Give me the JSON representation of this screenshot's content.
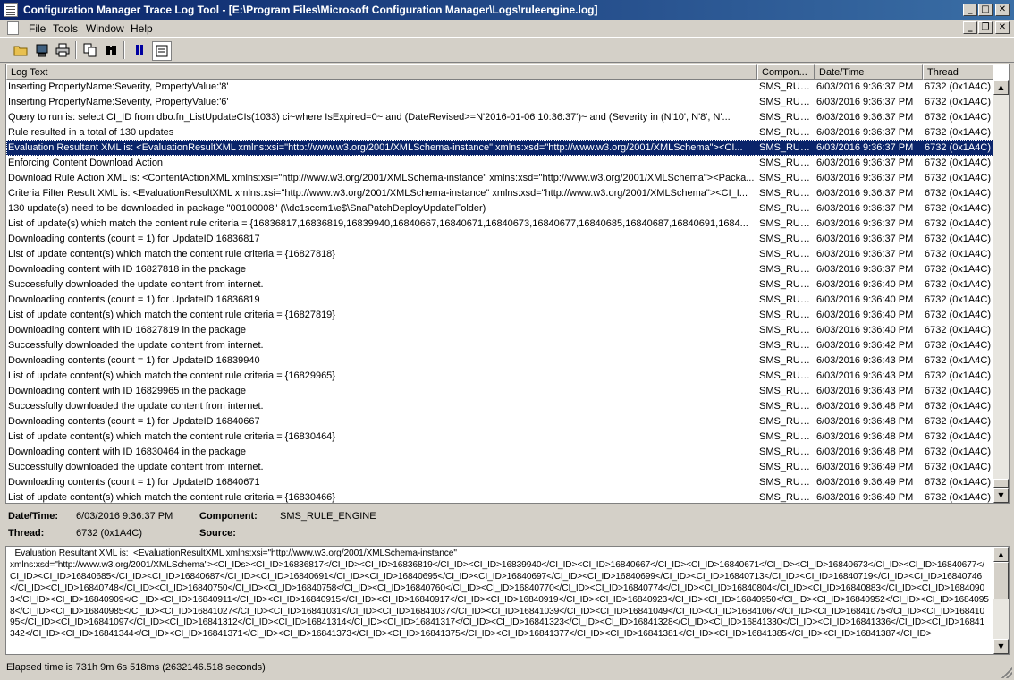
{
  "window": {
    "title": "Configuration Manager Trace Log Tool - [E:\\Program Files\\Microsoft Configuration Manager\\Logs\\ruleengine.log]"
  },
  "menu": [
    "File",
    "Tools",
    "Window",
    "Help"
  ],
  "toolbar": {
    "icons": [
      "open-folder-icon",
      "server-icon",
      "print-icon",
      "copy-icon",
      "find-icon",
      "pause-icon",
      "highlight-icon"
    ]
  },
  "columns": {
    "log_text": "Log Text",
    "component": "Compon...",
    "datetime": "Date/Time",
    "thread": "Thread"
  },
  "rows": [
    {
      "text": "    Inserting PropertyName:Severity, PropertyValue:'8'",
      "component": "SMS_RULE_I",
      "datetime": "6/03/2016 9:36:37 PM",
      "thread": "6732 (0x1A4C)"
    },
    {
      "text": "    Inserting PropertyName:Severity, PropertyValue:'6'",
      "component": "SMS_RULE_I",
      "datetime": "6/03/2016 9:36:37 PM",
      "thread": "6732 (0x1A4C)"
    },
    {
      "text": "  Query to run is: select CI_ID from dbo.fn_ListUpdateCIs(1033) ci~where IsExpired=0~  and (DateRevised>=N'2016-01-06 10:36:37')~  and (Severity in (N'10', N'8', N'...",
      "component": "SMS_RULE_I",
      "datetime": "6/03/2016 9:36:37 PM",
      "thread": "6732 (0x1A4C)"
    },
    {
      "text": "  Rule resulted in a total of 130 updates",
      "component": "SMS_RULE_I",
      "datetime": "6/03/2016 9:36:37 PM",
      "thread": "6732 (0x1A4C)"
    },
    {
      "text": "  Evaluation Resultant XML is:  <EvaluationResultXML xmlns:xsi=\"http://www.w3.org/2001/XMLSchema-instance\" xmlns:xsd=\"http://www.w3.org/2001/XMLSchema\"><CI...",
      "component": "SMS_RULE_I",
      "datetime": "6/03/2016 9:36:37 PM",
      "thread": "6732 (0x1A4C)",
      "selected": true
    },
    {
      "text": "Enforcing Content Download Action",
      "component": "SMS_RULE_I",
      "datetime": "6/03/2016 9:36:37 PM",
      "thread": "6732 (0x1A4C)"
    },
    {
      "text": "Download Rule Action XML is:  <ContentActionXML xmlns:xsi=\"http://www.w3.org/2001/XMLSchema-instance\" xmlns:xsd=\"http://www.w3.org/2001/XMLSchema\"><Packa...",
      "component": "SMS_RULE_I",
      "datetime": "6/03/2016 9:36:37 PM",
      "thread": "6732 (0x1A4C)"
    },
    {
      "text": "Criteria Filter Result XML is:  <EvaluationResultXML xmlns:xsi=\"http://www.w3.org/2001/XMLSchema-instance\" xmlns:xsd=\"http://www.w3.org/2001/XMLSchema\"><CI_I...",
      "component": "SMS_RULE_I",
      "datetime": "6/03/2016 9:36:37 PM",
      "thread": "6732 (0x1A4C)"
    },
    {
      "text": "130 update(s) need to be downloaded in package \"00100008\" (\\\\dc1sccm1\\e$\\SnaPatchDeployUpdateFolder)",
      "component": "SMS_RULE_I",
      "datetime": "6/03/2016 9:36:37 PM",
      "thread": "6732 (0x1A4C)"
    },
    {
      "text": "List of update(s) which match the content rule criteria = {16836817,16836819,16839940,16840667,16840671,16840673,16840677,16840685,16840687,16840691,1684...",
      "component": "SMS_RULE_I",
      "datetime": "6/03/2016 9:36:37 PM",
      "thread": "6732 (0x1A4C)"
    },
    {
      "text": "Downloading contents (count = 1) for UpdateID 16836817",
      "component": "SMS_RULE_I",
      "datetime": "6/03/2016 9:36:37 PM",
      "thread": "6732 (0x1A4C)"
    },
    {
      "text": "List of update content(s) which match the content rule criteria = {16827818}",
      "component": "SMS_RULE_I",
      "datetime": "6/03/2016 9:36:37 PM",
      "thread": "6732 (0x1A4C)"
    },
    {
      "text": "Downloading content with ID 16827818 in the package",
      "component": "SMS_RULE_I",
      "datetime": "6/03/2016 9:36:37 PM",
      "thread": "6732 (0x1A4C)"
    },
    {
      "text": "Successfully downloaded the update content from internet.",
      "component": "SMS_RULE_I",
      "datetime": "6/03/2016 9:36:40 PM",
      "thread": "6732 (0x1A4C)"
    },
    {
      "text": "Downloading contents (count = 1) for UpdateID 16836819",
      "component": "SMS_RULE_I",
      "datetime": "6/03/2016 9:36:40 PM",
      "thread": "6732 (0x1A4C)"
    },
    {
      "text": "List of update content(s) which match the content rule criteria = {16827819}",
      "component": "SMS_RULE_I",
      "datetime": "6/03/2016 9:36:40 PM",
      "thread": "6732 (0x1A4C)"
    },
    {
      "text": "Downloading content with ID 16827819 in the package",
      "component": "SMS_RULE_I",
      "datetime": "6/03/2016 9:36:40 PM",
      "thread": "6732 (0x1A4C)"
    },
    {
      "text": "Successfully downloaded the update content from internet.",
      "component": "SMS_RULE_I",
      "datetime": "6/03/2016 9:36:42 PM",
      "thread": "6732 (0x1A4C)"
    },
    {
      "text": "Downloading contents (count = 1) for UpdateID 16839940",
      "component": "SMS_RULE_I",
      "datetime": "6/03/2016 9:36:43 PM",
      "thread": "6732 (0x1A4C)"
    },
    {
      "text": "List of update content(s) which match the content rule criteria = {16829965}",
      "component": "SMS_RULE_I",
      "datetime": "6/03/2016 9:36:43 PM",
      "thread": "6732 (0x1A4C)"
    },
    {
      "text": "Downloading content with ID 16829965 in the package",
      "component": "SMS_RULE_I",
      "datetime": "6/03/2016 9:36:43 PM",
      "thread": "6732 (0x1A4C)"
    },
    {
      "text": "Successfully downloaded the update content from internet.",
      "component": "SMS_RULE_I",
      "datetime": "6/03/2016 9:36:48 PM",
      "thread": "6732 (0x1A4C)"
    },
    {
      "text": "Downloading contents (count = 1) for UpdateID 16840667",
      "component": "SMS_RULE_I",
      "datetime": "6/03/2016 9:36:48 PM",
      "thread": "6732 (0x1A4C)"
    },
    {
      "text": "List of update content(s) which match the content rule criteria = {16830464}",
      "component": "SMS_RULE_I",
      "datetime": "6/03/2016 9:36:48 PM",
      "thread": "6732 (0x1A4C)"
    },
    {
      "text": "Downloading content with ID 16830464 in the package",
      "component": "SMS_RULE_I",
      "datetime": "6/03/2016 9:36:48 PM",
      "thread": "6732 (0x1A4C)"
    },
    {
      "text": "Successfully downloaded the update content from internet.",
      "component": "SMS_RULE_I",
      "datetime": "6/03/2016 9:36:49 PM",
      "thread": "6732 (0x1A4C)"
    },
    {
      "text": "Downloading contents (count = 1) for UpdateID 16840671",
      "component": "SMS_RULE_I",
      "datetime": "6/03/2016 9:36:49 PM",
      "thread": "6732 (0x1A4C)"
    },
    {
      "text": "List of update content(s) which match the content rule criteria = {16830466}",
      "component": "SMS_RULE_I",
      "datetime": "6/03/2016 9:36:49 PM",
      "thread": "6732 (0x1A4C)"
    }
  ],
  "details": {
    "datetime_label": "Date/Time:",
    "datetime_value": "6/03/2016 9:36:37 PM",
    "component_label": "Component:",
    "component_value": "SMS_RULE_ENGINE",
    "thread_label": "Thread:",
    "thread_value": "6732 (0x1A4C)",
    "source_label": "Source:",
    "source_value": ""
  },
  "message": "  Evaluation Resultant XML is:  <EvaluationResultXML xmlns:xsi=\"http://www.w3.org/2001/XMLSchema-instance\"\nxmlns:xsd=\"http://www.w3.org/2001/XMLSchema\"><CI_IDs><CI_ID>16836817</CI_ID><CI_ID>16836819</CI_ID><CI_ID>16839940</CI_ID><CI_ID>16840667</CI_ID><CI_ID>16840671</CI_ID><CI_ID>16840673</CI_ID><CI_ID>16840677</CI_ID><CI_ID>16840685</CI_ID><CI_ID>16840687</CI_ID><CI_ID>16840691</CI_ID><CI_ID>16840695</CI_ID><CI_ID>16840697</CI_ID><CI_ID>16840699</CI_ID><CI_ID>16840713</CI_ID><CI_ID>16840719</CI_ID><CI_ID>16840746</CI_ID><CI_ID>16840748</CI_ID><CI_ID>16840750</CI_ID><CI_ID>16840758</CI_ID><CI_ID>16840760</CI_ID><CI_ID>16840770</CI_ID><CI_ID>16840774</CI_ID><CI_ID>16840804</CI_ID><CI_ID>16840883</CI_ID><CI_ID>16840903</CI_ID><CI_ID>16840909</CI_ID><CI_ID>16840911</CI_ID><CI_ID>16840915</CI_ID><CI_ID>16840917</CI_ID><CI_ID>16840919</CI_ID><CI_ID>16840923</CI_ID><CI_ID>16840950</CI_ID><CI_ID>16840952</CI_ID><CI_ID>16840958</CI_ID><CI_ID>16840985</CI_ID><CI_ID>16841027</CI_ID><CI_ID>16841031</CI_ID><CI_ID>16841037</CI_ID><CI_ID>16841039</CI_ID><CI_ID>16841049</CI_ID><CI_ID>16841067</CI_ID><CI_ID>16841075</CI_ID><CI_ID>16841095</CI_ID><CI_ID>16841097</CI_ID><CI_ID>16841312</CI_ID><CI_ID>16841314</CI_ID><CI_ID>16841317</CI_ID><CI_ID>16841323</CI_ID><CI_ID>16841328</CI_ID><CI_ID>16841330</CI_ID><CI_ID>16841336</CI_ID><CI_ID>16841342</CI_ID><CI_ID>16841344</CI_ID><CI_ID>16841371</CI_ID><CI_ID>16841373</CI_ID><CI_ID>16841375</CI_ID><CI_ID>16841377</CI_ID><CI_ID>16841381</CI_ID><CI_ID>16841385</CI_ID><CI_ID>16841387</CI_ID>",
  "status": "Elapsed time is 731h 9m 6s 518ms (2632146.518 seconds)",
  "colors": {
    "title_start": "#0a246a",
    "title_end": "#3a6ea5",
    "selection": "#0a246a",
    "chrome": "#d4d0c8"
  }
}
